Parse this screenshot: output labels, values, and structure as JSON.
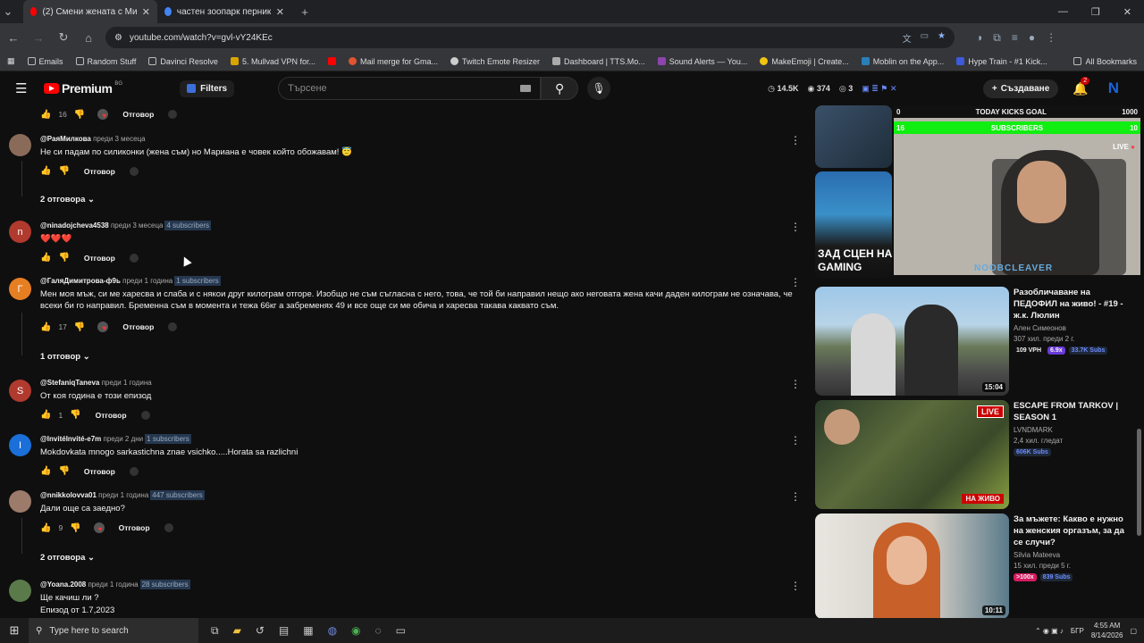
{
  "browser": {
    "tabs": [
      {
        "title": "(2) Смени жената с Мис Бълга",
        "active": true,
        "color": "#ff0000"
      },
      {
        "title": "частен зоопарк перник - Goo",
        "active": false,
        "color": "#4285f4"
      }
    ],
    "url": "youtube.com/watch?v=gvl-vY24KEc",
    "bookmarks": [
      "Emails",
      "Random Stuff",
      "Davinci Resolve",
      "5. Mullvad VPN for...",
      "",
      "Mail merge for Gma...",
      "Twitch Emote Resizer",
      "Dashboard | TTS.Mo...",
      "Sound Alerts — You...",
      "MakeEmoji | Create...",
      "Moblin on the App...",
      "Hype Train - #1 Kick..."
    ],
    "all_bookmarks": "All Bookmarks"
  },
  "header": {
    "logo": "Premium",
    "country": "BG",
    "filters": "Filters",
    "search_placeholder": "Търсене",
    "stat1": "14.5K",
    "stat2": "374",
    "stat3": "3",
    "create": "Създаване",
    "notif_count": "2"
  },
  "comments": [
    {
      "type": "actions",
      "likes": "16",
      "heart": true
    },
    {
      "type": "comment",
      "avatar": "",
      "avatar_color": "#8a6b5a",
      "user": "@РаяМилкова",
      "time": "преди 3 месеца",
      "subs": "",
      "text": "Не си падам по силиконки (жена съм) но Мариана е човек който обожавам! 😇",
      "likes": "",
      "heart": false
    },
    {
      "type": "replies",
      "label": "2 отговора"
    },
    {
      "type": "comment",
      "avatar": "n",
      "avatar_color": "#c0392b",
      "user": "@ninadojcheva4538",
      "time": "преди 3 месеца",
      "subs": "4 subscribers",
      "text": "❤️❤️❤️",
      "likes": "",
      "heart": false
    },
    {
      "type": "comment",
      "avatar": "Г",
      "avatar_color": "#e67e22",
      "user": "@ГаляДимитрова-ф9ь",
      "time": "преди 1 година",
      "subs": "1 subscribers",
      "text": "Мен моя мъж, си ме харесва и слаба и с някои друг килограм отгоре. Изобщо не съм съгласна с него, това, че той би направил нещо ако неговата жена качи даден килограм не означава, че всеки би го направил. Бременна съм в момента и тежа 66кг а забременях 49 и все още си ме обича и харесва такава каквато съм.",
      "likes": "17",
      "heart": true
    },
    {
      "type": "replies",
      "label": "1 отговор"
    },
    {
      "type": "comment",
      "avatar": "S",
      "avatar_color": "#c0392b",
      "user": "@StefaniqTaneva",
      "time": "преди 1 година",
      "subs": "",
      "text": "От коя година е този епизод",
      "likes": "1",
      "heart": false
    },
    {
      "type": "comment",
      "avatar": "I",
      "avatar_color": "#1a6fd8",
      "user": "@InvitéInvité-e7m",
      "time": "преди 2 дни",
      "subs": "1 subscribers",
      "text": "Mokdovkata mnogo sarkastichna znae vsichko.....Horata sa razlichni",
      "likes": "",
      "heart": false
    },
    {
      "type": "comment",
      "avatar": "",
      "avatar_color": "#9c7b6b",
      "user": "@nnikkolovva01",
      "time": "преди 1 година",
      "subs": "447 subscribers",
      "text": "Дали още са заедно?",
      "likes": "9",
      "heart": true
    },
    {
      "type": "replies",
      "label": "2 отговора"
    },
    {
      "type": "comment",
      "avatar": "",
      "avatar_color": "#5a7a4a",
      "user": "@Yoana.2008",
      "time": "преди 1 година",
      "subs": "28 subscribers",
      "text": "Ще качиш ли ?",
      "text2": "Епизод от 1.7,2023",
      "likes": "",
      "heart": false
    }
  ],
  "reply_label": "Отговор",
  "overlay": {
    "goal": "TODAY KICKS GOAL",
    "goal_left": "0",
    "goal_right": "1000",
    "subs": "SUBSCRIBERS",
    "subs_left": "16",
    "subs_right": "10",
    "live": "LIVE",
    "name": "NOOBCLEAVER"
  },
  "recommendations": [
    {
      "title": "",
      "channel": "",
      "views": "",
      "dur": "",
      "thumb_text": "ЗАД СЦЕН НА GAMING"
    },
    {
      "title": "Разобличаване на ПЕДОФИЛ на живо! - #19 - ж.к. Люлин",
      "channel": "Ален Симеонов",
      "views": "307 хил.  преди 2 г.",
      "dur": "15:04",
      "tag1": "109 VPH",
      "tag2": "6.9x",
      "tag3": "33.7K Subs"
    },
    {
      "title": "ESCAPE FROM TARKOV | SEASON 1",
      "channel": "LVNDMARK",
      "views": "2,4 хил. гледат",
      "dur": "",
      "live": "НА ЖИВО",
      "live_badge": "LIVE",
      "tag3": "606K Subs"
    },
    {
      "title": "За мъжете: Какво е нужно на женския оргазъм, за да се случи?",
      "channel": "Silvia Mateeva",
      "views": "15 хил.  преди 5 г.",
      "dur": "10:11",
      "tag2": ">100x",
      "tag3": "839 Subs"
    }
  ],
  "taskbar": {
    "search": "Type here to search",
    "lang": "БГР",
    "time": "4:55 AM",
    "date": "8/14/2026"
  }
}
